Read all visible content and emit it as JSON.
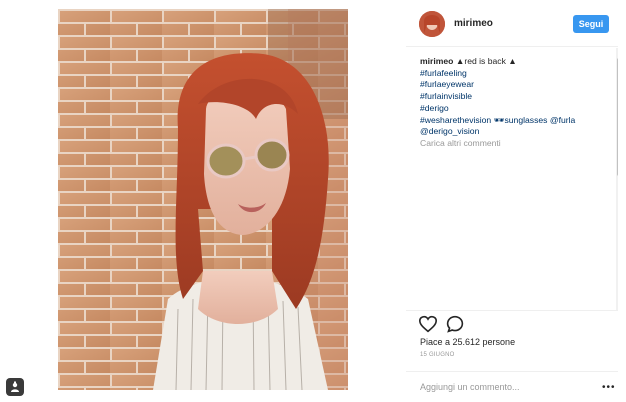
{
  "post": {
    "username": "mirimeo",
    "follow_label": "Segui",
    "caption": {
      "user": "mirimeo",
      "text": "▲red is back ▲",
      "tags": [
        "#furlafeeling",
        "#furlaeyewear",
        "#furlainvisible",
        "#derigo"
      ],
      "line_sunglasses": "#wesharethevision 🕶sunglasses @furla",
      "line_vision": "@derigo_vision"
    },
    "load_more": "Carica altri commenti",
    "likes": "Piace a 25.612 persone",
    "date": "15 GIUGNO",
    "comment_placeholder": "Aggiungi un commento...",
    "more_icon": "•••"
  },
  "icons": {
    "heart": "heart-icon",
    "comment": "comment-bubble-icon",
    "more": "more-options-icon",
    "badge": "profile-badge-icon"
  },
  "colors": {
    "accent": "#3897f0",
    "hair": "#b8452a",
    "brick": "#c98a60"
  }
}
